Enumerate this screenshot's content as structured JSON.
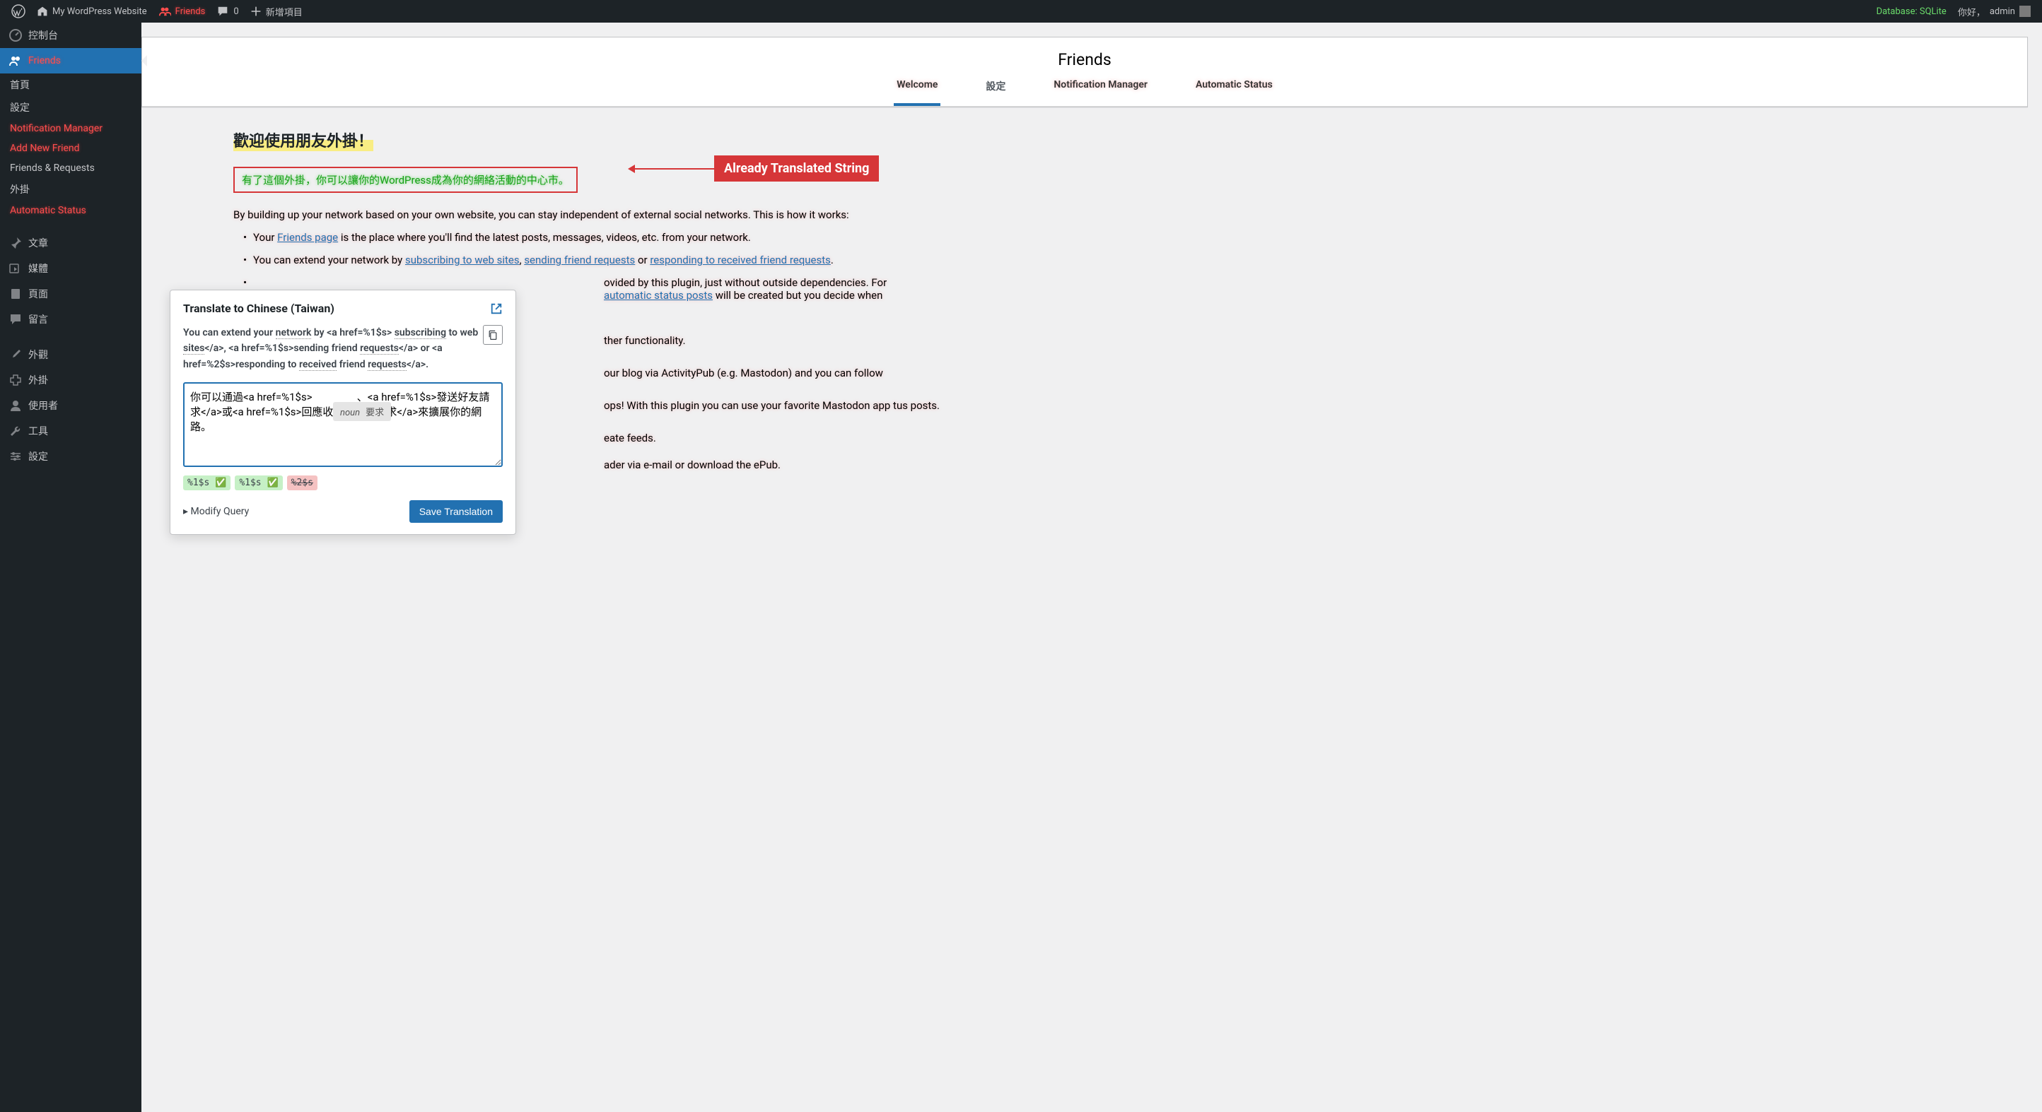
{
  "adminbar": {
    "site_name": "My WordPress Website",
    "friends": "Friends",
    "comments_count": "0",
    "new_item": "新增項目",
    "database": "Database: SQLite",
    "greeting_prefix": "你好，",
    "greeting_user": "admin"
  },
  "sidebar": {
    "dashboard": "控制台",
    "friends": "Friends",
    "sub_home": "首頁",
    "sub_settings": "設定",
    "sub_notification": "Notification Manager",
    "sub_add_friend": "Add New Friend",
    "sub_friends_requests": "Friends & Requests",
    "sub_plugins": "外掛",
    "sub_auto_status": "Automatic Status",
    "posts": "文章",
    "media": "媒體",
    "pages": "頁面",
    "comments": "留言",
    "appearance": "外觀",
    "plugins": "外掛",
    "users": "使用者",
    "tools": "工具",
    "settings": "設定"
  },
  "page": {
    "title": "Friends",
    "tabs": {
      "welcome": "Welcome",
      "settings": "設定",
      "notification": "Notification Manager",
      "auto_status": "Automatic Status"
    }
  },
  "content": {
    "welcome_heading": "歡迎使用朋友外掛！",
    "translated_string": "有了這個外掛，你可以讓你的WordPress成為你的網絡活動的中心市。",
    "annotation_label": "Already Translated String",
    "intro": "By building up your network based on your own website, you can stay independent of external social networks. This is how it works:",
    "li1_pre": "Your ",
    "li1_link": "Friends page",
    "li1_post": " is the place where you'll find the latest posts, messages, videos, etc. from your network.",
    "li2_pre": "You can extend your network by ",
    "li2_link1": "subscribing to web sites",
    "li2_mid1": ", ",
    "li2_link2": "sending friend requests",
    "li2_mid2": " or ",
    "li2_link3": "responding to received friend requests",
    "li2_post": ".",
    "li3_part1": "ovided by this plugin, just without outside dependencies. For ",
    "li3_link": "automatic status posts",
    "li3_part2": " will be created but you decide when",
    "li4": "ther functionality.",
    "li5": "our blog via ActivityPub (e.g. Mastodon) and you can follow",
    "li6": "ops! With this plugin you can use your favorite Mastodon app tus posts.",
    "li7": "eate feeds.",
    "li8": "ader via e-mail or download the ePub."
  },
  "popup": {
    "title": "Translate to Chinese (Taiwan)",
    "source": "You can extend your <span class='u'>network</span> by &lt;a href=%1$s&gt; <span class='u'>subscribing</span> to web <span class='u'>sites</span>&lt;/a&gt;, &lt;a href=%1$s&gt;sending friend <span class='u'>requests</span>&lt;/a&gt; or &lt;a href=%2$s&gt;responding to <span class='u'>received</span> friend <span class='u'>requests</span>&lt;/a&gt;.",
    "hint_pos": "noun",
    "hint_text": "要求",
    "translation": "你可以通過<a href=%1$s>                 、<a href=%1$s>發送好友請求</a>或<a href=%1$s>回應收到的好友請求</a>來擴展你的網路。",
    "ph1": "%1$s ✅",
    "ph2": "%1$s ✅",
    "ph3": "%2$s",
    "modify": "▸ Modify Query",
    "save": "Save Translation"
  }
}
